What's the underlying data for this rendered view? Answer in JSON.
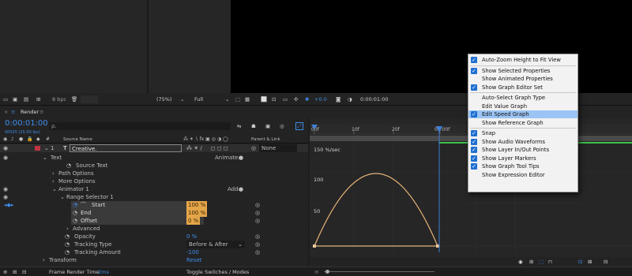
{
  "viewer": {
    "bpc": "8 bpc",
    "zoom": "(75%)",
    "resolution": "Full",
    "exposure": "+0.0",
    "timecode": "0:00:01:00"
  },
  "panel": {
    "tab": "Render",
    "time": "0:00:01:00",
    "frame_info": "00025 (25.00 fps)",
    "search_placeholder": "ρ."
  },
  "columns": {
    "source_name": "Source Name",
    "parent": "Parent & Link"
  },
  "layer": {
    "number": "1",
    "type_icon": "T",
    "name": "Creative.",
    "parent": "None"
  },
  "props": {
    "text": "Text",
    "animate": "Animate:",
    "source_text": "Source Text",
    "path_options": "Path Options",
    "more_options": "More Options",
    "animator": "Animator 1",
    "add": "Add:",
    "range_selector": "Range Selector 1",
    "start": "Start",
    "start_val": "100 %",
    "end": "End",
    "end_val": "100 %",
    "offset": "Offset",
    "offset_val": "0 %",
    "advanced": "Advanced",
    "opacity": "Opacity",
    "opacity_val": "0 %",
    "tracking_type": "Tracking Type",
    "tracking_type_val": "Before & After",
    "tracking_amount": "Tracking Amount",
    "tracking_amount_val": "-100",
    "transform": "Transform",
    "transform_val": "Reset"
  },
  "bottom": {
    "frame_render": "Frame Render Time",
    "frame_render_val": "2ms",
    "toggle": "Toggle Switches / Modes"
  },
  "graph": {
    "ruler": [
      "00f",
      "10f",
      "20f",
      "01:00f"
    ],
    "unit_label": "150 %/sec",
    "y_labels": [
      "100",
      "50"
    ],
    "curve_color": "#e7b37a",
    "playhead_color": "#3f7fd8"
  },
  "menu": {
    "items": [
      {
        "label": "Auto-Zoom Height to Fit View",
        "checked": true
      },
      {
        "label": "Show Selected Properties",
        "checked": true
      },
      {
        "label": "Show Animated Properties",
        "checked": false
      },
      {
        "label": "Show Graph Editor Set",
        "checked": true
      },
      {
        "label": "Auto-Select Graph Type",
        "checked": false
      },
      {
        "label": "Edit Value Graph",
        "checked": false
      },
      {
        "label": "Edit Speed Graph",
        "checked": true
      },
      {
        "label": "Show Reference Graph",
        "checked": false
      },
      {
        "label": "Snap",
        "checked": true
      },
      {
        "label": "Show Audio Waveforms",
        "checked": true
      },
      {
        "label": "Show Layer In/Out Points",
        "checked": true
      },
      {
        "label": "Show Layer Markers",
        "checked": true
      },
      {
        "label": "Show Graph Tool Tips",
        "checked": true
      },
      {
        "label": "Show Expression Editor",
        "checked": false
      }
    ]
  }
}
